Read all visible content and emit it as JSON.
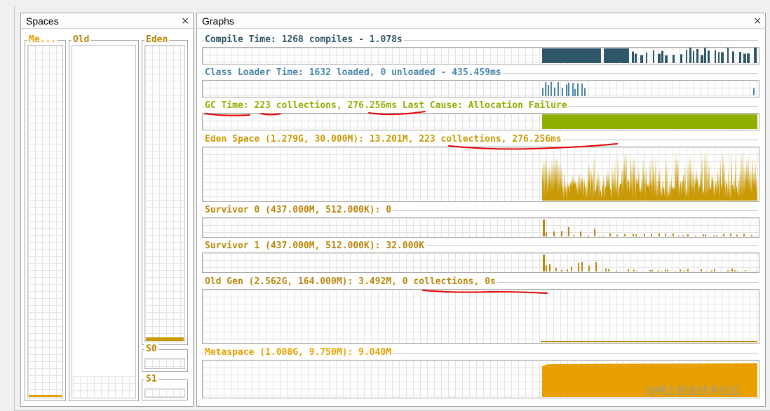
{
  "spaces_panel": {
    "title": "Spaces",
    "close": "×",
    "columns": {
      "metaspace": {
        "label": "Me..."
      },
      "old": {
        "label": "Old"
      },
      "eden": {
        "label": "Eden"
      },
      "s0": {
        "label": "S0"
      },
      "s1": {
        "label": "S1"
      }
    }
  },
  "graphs_panel": {
    "title": "Graphs",
    "close": "×",
    "graphs": [
      {
        "label": "Compile Time: 1268 compiles - 1.078s",
        "color": "#2e5568"
      },
      {
        "label": "Class Loader Time: 1632 loaded, 0 unloaded - 435.459ms",
        "color": "#4a86a8"
      },
      {
        "label": "GC Time: 223 collections, 276.256ms Last Cause: Allocation Failure",
        "color": "#8fb000"
      },
      {
        "label": "Eden Space (1.279G, 30.000M): 13.201M, 223 collections, 276.256ms",
        "color": "#c99a05"
      },
      {
        "label": "Survivor 0 (437.000M, 512.000K): 0",
        "color": "#b8860b"
      },
      {
        "label": "Survivor 1 (437.000M, 512.000K): 32.000K",
        "color": "#b8860b"
      },
      {
        "label": "Old Gen (2.562G, 164.000M): 3.492M, 0 collections, 0s",
        "color": "#b8860b"
      },
      {
        "label": "Metaspace (1.008G, 9.750M): 9.040M",
        "color": "#e8a000"
      }
    ]
  },
  "watermark": "@稀土掘金技术社区",
  "colors": {
    "annotation": "#e60000",
    "label_gold": "#b8860b"
  }
}
